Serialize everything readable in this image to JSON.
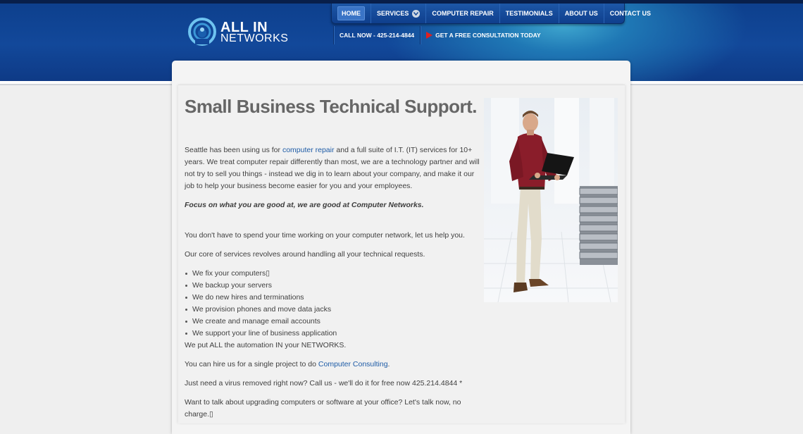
{
  "logo": {
    "line1": "ALL IN",
    "line2": "NETWORKS"
  },
  "nav": {
    "items": [
      {
        "label": "HOME",
        "active": true
      },
      {
        "label": "SERVICES",
        "has_dropdown": true
      },
      {
        "label": "COMPUTER REPAIR"
      },
      {
        "label": "TESTIMONIALS"
      },
      {
        "label": "ABOUT US"
      },
      {
        "label": "CONTACT US"
      }
    ]
  },
  "subnav": {
    "call": "CALL NOW - 425-214-4844",
    "consult": "GET A FREE CONSULTATION TODAY"
  },
  "main": {
    "title": "Small Business Technical Support.",
    "intro": {
      "pre": "Seattle has been using us for ",
      "link": "computer repair",
      "post": " and a full suite of I.T. (IT) services for 10+ years. We treat computer repair differently than most, we are a technology partner and will not try to sell you things - instead we dig in to learn about your company, and make it our job to help your business become easier for you and your employees."
    },
    "focus": "Focus on what you are good at, we are good at Computer Networks.",
    "p_help": "You don't have to spend your time working on your computer network, let us help you.",
    "p_core": "Our core of services revolves around handling all your technical requests.",
    "services": [
      "We fix your computers▯",
      "We backup your servers",
      "We do new hires and terminations",
      "We provision phones and move data jacks",
      "We create and manage email accounts",
      "We support your line of business application"
    ],
    "automation": "We put ALL the automation IN your NETWORKS.",
    "hire": {
      "pre": "You can hire us for a single project to do ",
      "link": "Computer Consulting",
      "post": "."
    },
    "virus": "Just need a virus removed right now? Call us - we'll do it for free now 425.214.4844 *",
    "upgrade": "Want to talk about upgrading computers or software at your office? Let's talk now, no charge.▯"
  },
  "colors": {
    "header_blue": "#12489a",
    "link_blue": "#1d5ba6",
    "title_gray": "#666666",
    "flag_red": "#e02020"
  }
}
